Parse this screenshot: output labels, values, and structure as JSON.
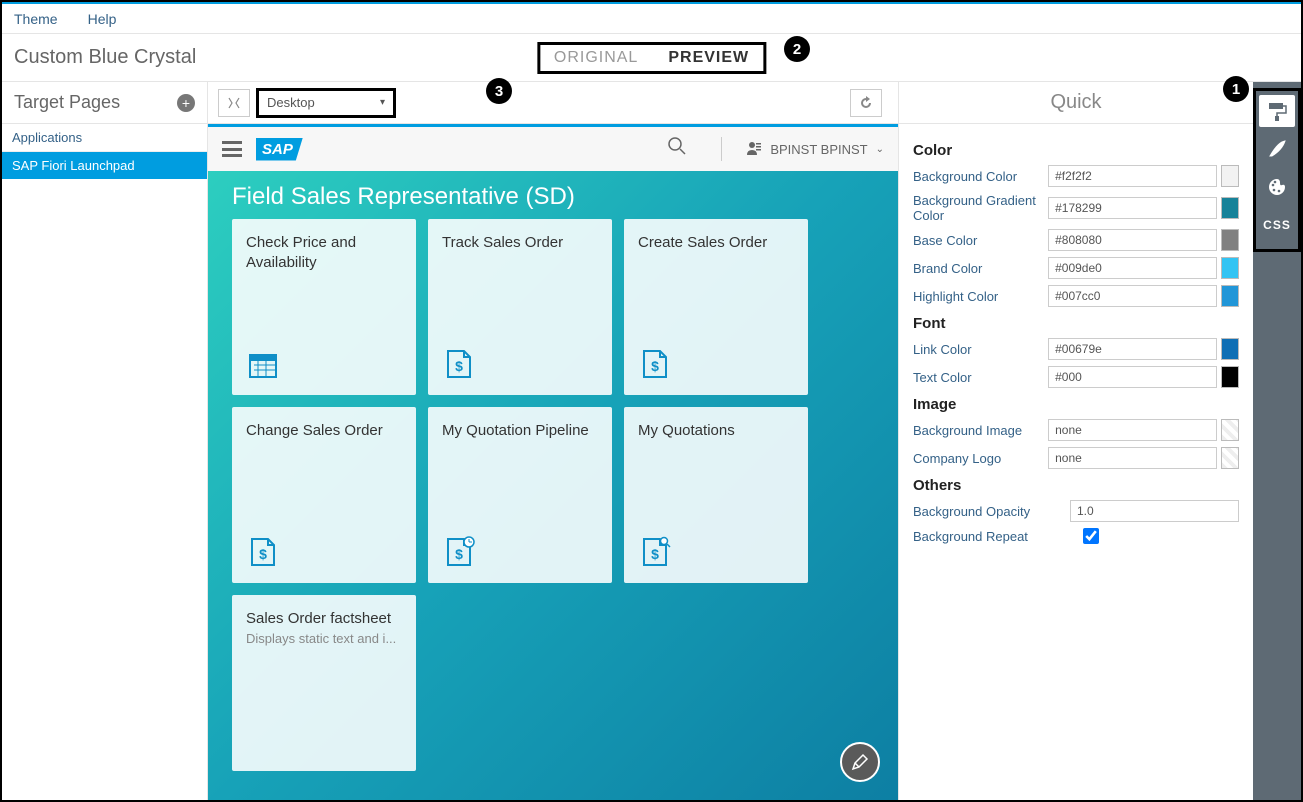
{
  "menu": {
    "theme": "Theme",
    "help": "Help"
  },
  "title": "Custom Blue Crystal",
  "tabs": {
    "original": "ORIGINAL",
    "preview": "PREVIEW"
  },
  "sidebar": {
    "title": "Target Pages",
    "section": "Applications",
    "item": "SAP Fiori Launchpad"
  },
  "toolbar": {
    "device": "Desktop"
  },
  "shell": {
    "logo": "SAP",
    "user": "BPINST BPINST"
  },
  "group": {
    "title": "Field Sales Representative (SD)"
  },
  "tiles": [
    {
      "title": "Check Price and Availability",
      "icon": "calendar"
    },
    {
      "title": "Track Sales Order",
      "icon": "dollar-doc"
    },
    {
      "title": "Create Sales Order",
      "icon": "dollar-doc"
    },
    {
      "title": "Change Sales Order",
      "icon": "dollar-doc"
    },
    {
      "title": "My Quotation Pipeline",
      "icon": "dollar-doc-clock"
    },
    {
      "title": "My Quotations",
      "icon": "dollar-doc-search"
    },
    {
      "title": "Sales Order factsheet",
      "sub": "Displays static text and i...",
      "icon": ""
    }
  ],
  "quick": {
    "title": "Quick",
    "sections": {
      "color": "Color",
      "font": "Font",
      "image": "Image",
      "others": "Others"
    },
    "props": {
      "bgc": {
        "label": "Background Color",
        "value": "#f2f2f2",
        "swatch": "#f2f2f2"
      },
      "bgg": {
        "label": "Background Gradient Color",
        "value": "#178299",
        "swatch": "#178299"
      },
      "base": {
        "label": "Base Color",
        "value": "#808080",
        "swatch": "#808080"
      },
      "brand": {
        "label": "Brand Color",
        "value": "#009de0",
        "swatch": "#33c4f3"
      },
      "hl": {
        "label": "Highlight Color",
        "value": "#007cc0",
        "swatch": "#2196d8"
      },
      "link": {
        "label": "Link Color",
        "value": "#00679e",
        "swatch": "#0f6fb5"
      },
      "text": {
        "label": "Text Color",
        "value": "#000",
        "swatch": "#000000"
      },
      "bgimg": {
        "label": "Background Image",
        "value": "none"
      },
      "logo": {
        "label": "Company Logo",
        "value": "none"
      },
      "opacity": {
        "label": "Background Opacity",
        "value": "1.0"
      },
      "repeat": {
        "label": "Background Repeat"
      }
    }
  },
  "rail": {
    "css": "CSS"
  },
  "badges": {
    "b1": "1",
    "b2": "2",
    "b3": "3"
  }
}
